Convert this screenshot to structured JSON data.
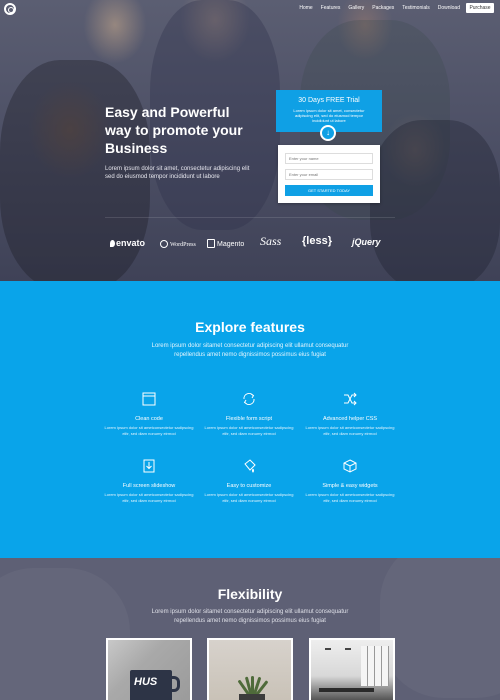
{
  "nav": {
    "links": [
      "Home",
      "Features",
      "Gallery",
      "Packages",
      "Testimonials",
      "Download"
    ],
    "purchase": "Purchase"
  },
  "hero": {
    "title": "Easy and Powerful way to promote your Business",
    "subtitle": "Lorem ipsum dolor sit amet, consectetur adipiscing elit sed do eiusmod tempor incididunt ut labore",
    "trial": {
      "title": "30 Days FREE Trial",
      "description": "Lorem ipsum dolor sit amet, consectetur adipiscing elit, sed do eiusmod tempor incididunt ut labore",
      "name_placeholder": "Enter your name",
      "email_placeholder": "Enter your email",
      "cta": "GET STARTED TODAY"
    },
    "brands": [
      "envato",
      "WordPress",
      "Magento",
      "Sass",
      "{less}",
      "jQuery"
    ]
  },
  "features": {
    "title": "Explore features",
    "subtitle": "Lorem ipsum dolor sitamet consectetur adipiscing elit ullamut consequatur repellendus amet nemo dignissimos possimus eius fugiat",
    "items": [
      {
        "name": "Clean code",
        "icon": "browser-window-icon",
        "desc": "Lorem ipsum dolor sit ametconsectetur sadipscing elitr, sed diam nonumy eirmod"
      },
      {
        "name": "Flexible form script",
        "icon": "refresh-icon",
        "desc": "Lorem ipsum dolor sit ametconsectetur sadipscing elitr, sed diam nonumy eirmod"
      },
      {
        "name": "Advanced helper CSS",
        "icon": "shuffle-icon",
        "desc": "Lorem ipsum dolor sit ametconsectetur sadipscing elitr, sed diam nonumy eirmod"
      },
      {
        "name": "Full screen slideshow",
        "icon": "download-box-icon",
        "desc": "Lorem ipsum dolor sit ametconsectetur sadipscing elitr, sed diam nonumy eirmod"
      },
      {
        "name": "Easy to customize",
        "icon": "paint-bucket-icon",
        "desc": "Lorem ipsum dolor sit ametconsectetur sadipscing elitr, sed diam nonumy eirmod"
      },
      {
        "name": "Simple & easy widgets",
        "icon": "boxes-icon",
        "desc": "Lorem ipsum dolor sit ametconsectetur sadipscing elitr, sed diam nonumy eirmod"
      }
    ]
  },
  "flexibility": {
    "title": "Flexibility",
    "subtitle": "Lorem ipsum dolor sitamet consectetur adipiscing elit ullamut consequatur repellendus amet nemo dignissimos possimus eius fugiat",
    "mug_text": "HUS"
  },
  "colors": {
    "accent": "#09a4ea",
    "hero_overlay": "#4a4d63",
    "flex_bg": "#5e6075"
  }
}
